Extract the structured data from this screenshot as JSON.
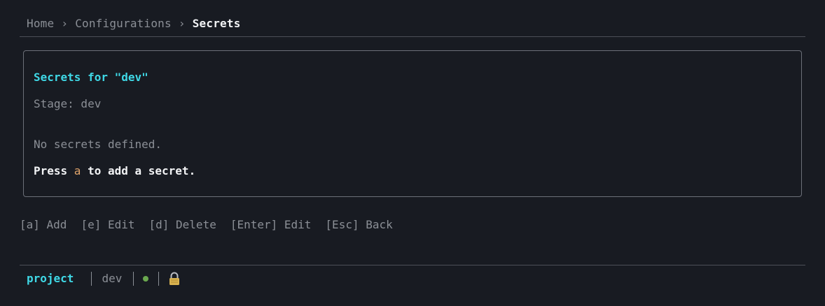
{
  "breadcrumb": {
    "items": [
      "Home",
      "Configurations",
      "Secrets"
    ],
    "separator": "›"
  },
  "panel": {
    "title": "Secrets for \"dev\"",
    "stage_text": "Stage: dev",
    "empty_text": "No secrets defined.",
    "hint_prefix": "Press ",
    "hint_key": "a",
    "hint_suffix": " to add a secret."
  },
  "keybar": {
    "add": "[a] Add",
    "edit": "[e] Edit",
    "delete": "[d] Delete",
    "enter_edit": "[Enter] Edit",
    "back": "[Esc] Back"
  },
  "status": {
    "project": "project",
    "stage": "dev",
    "connection_icon": "status-dot-icon",
    "lock_icon": "lock-icon"
  },
  "colors": {
    "accent": "#3fd8e6",
    "key_highlight": "#e0a46b",
    "status_ok": "#6aa84f",
    "background": "#181b22"
  }
}
